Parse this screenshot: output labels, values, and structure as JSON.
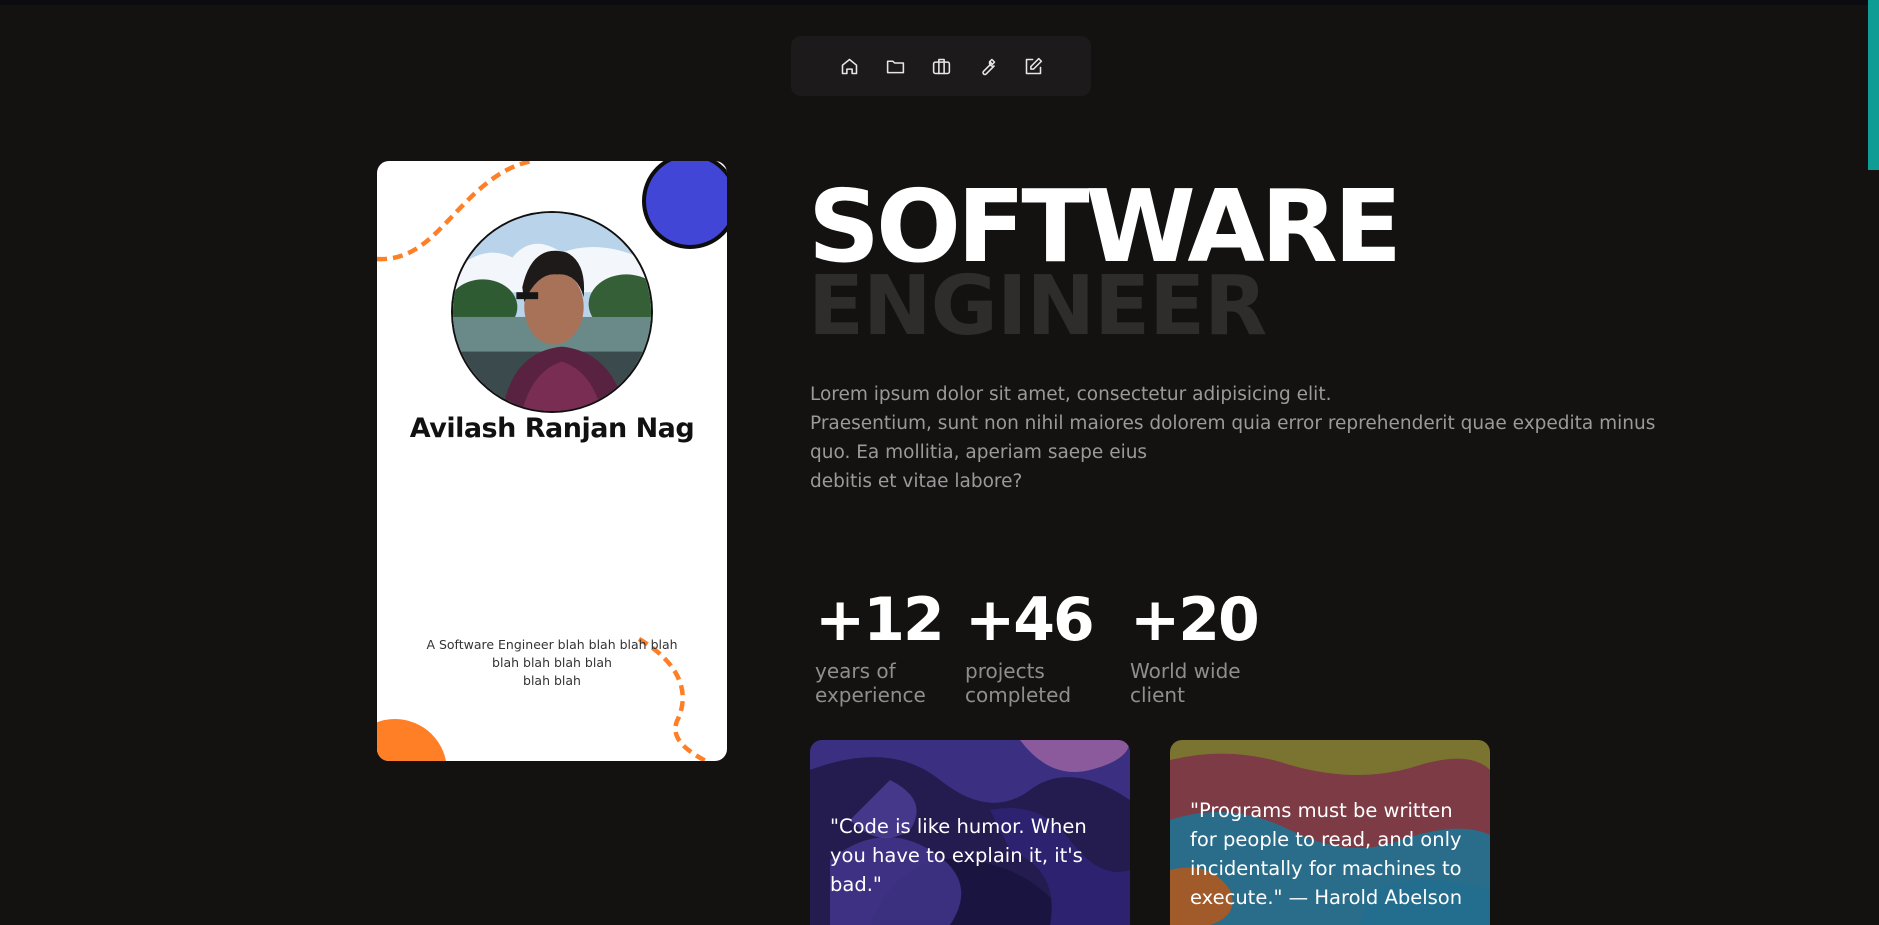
{
  "nav": {
    "items": [
      {
        "id": "home",
        "icon": "home-icon"
      },
      {
        "id": "projects",
        "icon": "folder-icon"
      },
      {
        "id": "experience",
        "icon": "briefcase-icon"
      },
      {
        "id": "skills",
        "icon": "wrench-icon"
      },
      {
        "id": "contact",
        "icon": "edit-icon"
      }
    ]
  },
  "profile": {
    "name": "Avilash Ranjan Nag",
    "bio": "A Software Engineer blah blah blah blah\nblah blah blah blah\nblah blah"
  },
  "hero": {
    "title_line1": "SOFTWARE",
    "title_line2": "ENGINEER",
    "intro_line1": "Lorem ipsum dolor sit amet, consectetur adipisicing elit.",
    "intro_line2": "Praesentium, sunt non nihil maiores dolorem quia error reprehenderit quae expedita minus quo. Ea mollitia, aperiam saepe eius",
    "intro_line3": "debitis et vitae labore?"
  },
  "stats": [
    {
      "value": "+12",
      "label": "years of\nexperience"
    },
    {
      "value": "+46",
      "label": "projects\ncompleted"
    },
    {
      "value": "+20",
      "label": "World wide\nclient"
    }
  ],
  "quotes": [
    {
      "text": "\"Code is like humor. When you have to explain it, it's bad.\""
    },
    {
      "text": "\"Programs must be written for people to read, and only incidentally for machines to execute.\" — Harold Abelson"
    }
  ],
  "colors": {
    "background": "#141111",
    "accent_orange": "#ff7f27",
    "accent_blue": "#4146d6",
    "scroll_accent": "#0f9c95"
  }
}
